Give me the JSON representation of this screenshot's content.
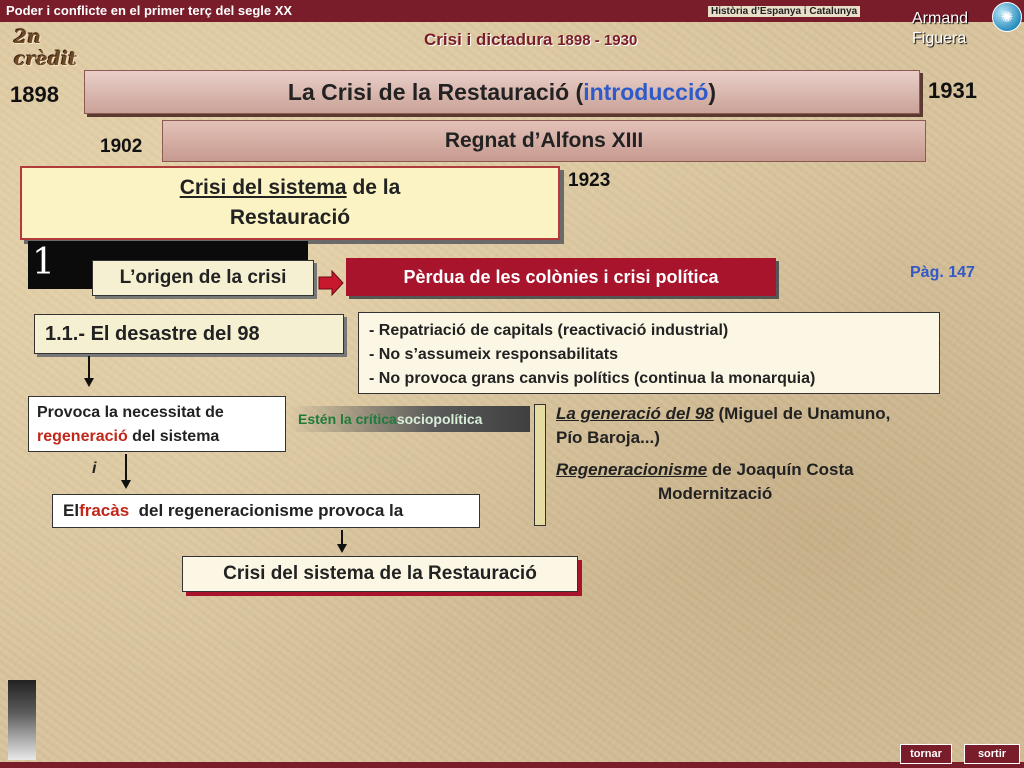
{
  "header": {
    "course_title": "Poder i conflicte en el primer terç del segle XX",
    "subject": "Història d’Espanya i Catalunya",
    "credit": "2n crèdit",
    "unit_title": "Crisi i dictadura",
    "unit_years": "1898 - 1930",
    "author_line1": "Armand",
    "author_line2": "Figuera"
  },
  "timeline": {
    "start_year": "1898",
    "end_year": "1931",
    "main_title_pre": "La Crisi de la Restauració (",
    "main_title_highlight": "introducció",
    "main_title_post": ")",
    "reign_start": "1902",
    "reign_label": "Regnat d’Alfons XIII",
    "reign_end": "1923"
  },
  "crisis": {
    "title_underlined": "Crisi del sistema",
    "title_rest": " de la",
    "title_line2": "Restauració"
  },
  "section": {
    "number": "1",
    "origin_label": "L’origen de la crisi",
    "colonies_label": "Pèrdua de les colònies i crisi política",
    "page_ref": "Pàg. 147"
  },
  "desastre": {
    "title": "1.1.- El desastre del 98",
    "consequences": [
      "- Repatriació de capitals (reactivació industrial)",
      "- No s’assumeix responsabilitats",
      "- No provoca grans canvis polítics (continua la monarquia)"
    ]
  },
  "regeneracio": {
    "line1": "Provoca la necessitat de",
    "highlight": "regeneració",
    "line2_rest": " del sistema",
    "critica_pre": "Estén la crítica ",
    "critica_light": "sociopolítica",
    "gen98_link": "La generació del 98",
    "gen98_rest": " (Miguel de Unamuno,",
    "gen98_line2": "Pío Baroja...)",
    "regen_link": "Regeneracionisme",
    "regen_rest": " de Joaquín Costa",
    "modern": "Modernització",
    "i_label": "i"
  },
  "fracas": {
    "pre": "El ",
    "highlight": "fracàs",
    "post": "  del regeneracionisme provoca la"
  },
  "result": {
    "label": "Crisi del sistema de la Restauració"
  },
  "nav": {
    "tornar": "tornar",
    "sortir": "sortir"
  },
  "colors": {
    "accent": "#7a1d2a",
    "red_box": "#a8142c",
    "highlight_blue": "#2d5bc8",
    "highlight_red": "#c0271a"
  }
}
